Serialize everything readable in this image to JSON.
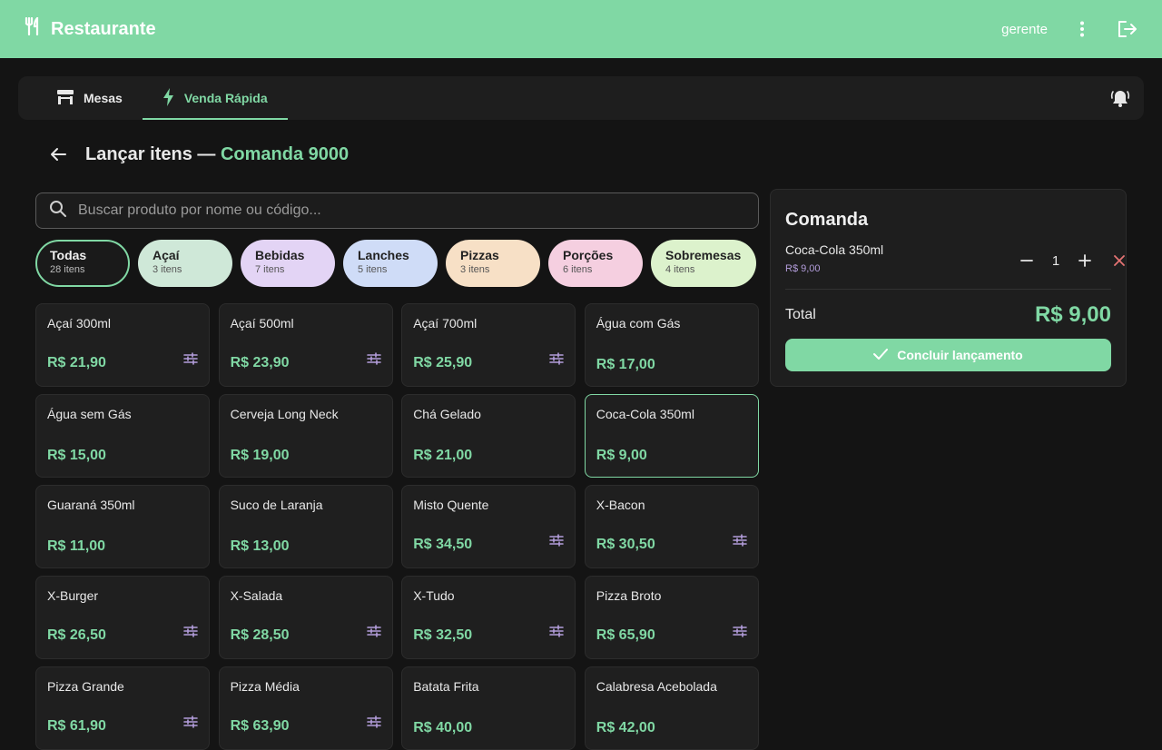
{
  "appbar": {
    "title": "Restaurante",
    "user": "gerente",
    "icons": [
      "fork-knife-icon",
      "more-vert-icon",
      "logout-icon"
    ]
  },
  "tabs": [
    {
      "label": "Mesas",
      "icon": "table-icon",
      "active": false
    },
    {
      "label": "Venda Rápida",
      "icon": "bolt-icon",
      "active": true
    }
  ],
  "heading": {
    "prefix": "Lançar itens —",
    "comanda": "Comanda 9000"
  },
  "search": {
    "placeholder": "Buscar produto por nome ou código...",
    "value": ""
  },
  "categories": [
    {
      "name": "Todas",
      "count": "28 itens",
      "color": "#1a1a1a",
      "active": true
    },
    {
      "name": "Açaí",
      "count": "3 itens",
      "color": "#cfe8d8"
    },
    {
      "name": "Bebidas",
      "count": "7 itens",
      "color": "#e3d4f5"
    },
    {
      "name": "Lanches",
      "count": "5 itens",
      "color": "#cfdcf7"
    },
    {
      "name": "Pizzas",
      "count": "3 itens",
      "color": "#f7e0c6"
    },
    {
      "name": "Porções",
      "count": "6 itens",
      "color": "#f5cfe0"
    },
    {
      "name": "Sobremesas",
      "count": "4 itens",
      "color": "#dcf2cc"
    }
  ],
  "products": [
    {
      "name": "Açaí 300ml",
      "price": "R$ 21,90",
      "options": true
    },
    {
      "name": "Açaí 500ml",
      "price": "R$ 23,90",
      "options": true
    },
    {
      "name": "Açaí 700ml",
      "price": "R$ 25,90",
      "options": true
    },
    {
      "name": "Água com Gás",
      "price": "R$ 17,00",
      "options": false
    },
    {
      "name": "Água sem Gás",
      "price": "R$ 15,00",
      "options": false
    },
    {
      "name": "Cerveja Long Neck",
      "price": "R$ 19,00",
      "options": false
    },
    {
      "name": "Chá Gelado",
      "price": "R$ 21,00",
      "options": false
    },
    {
      "name": "Coca-Cola 350ml",
      "price": "R$ 9,00",
      "options": false,
      "selected": true
    },
    {
      "name": "Guaraná 350ml",
      "price": "R$ 11,00",
      "options": false
    },
    {
      "name": "Suco de Laranja",
      "price": "R$ 13,00",
      "options": false
    },
    {
      "name": "Misto Quente",
      "price": "R$ 34,50",
      "options": true
    },
    {
      "name": "X-Bacon",
      "price": "R$ 30,50",
      "options": true
    },
    {
      "name": "X-Burger",
      "price": "R$ 26,50",
      "options": true
    },
    {
      "name": "X-Salada",
      "price": "R$ 28,50",
      "options": true
    },
    {
      "name": "X-Tudo",
      "price": "R$ 32,50",
      "options": true
    },
    {
      "name": "Pizza Broto",
      "price": "R$ 65,90",
      "options": true
    },
    {
      "name": "Pizza Grande",
      "price": "R$ 61,90",
      "options": true
    },
    {
      "name": "Pizza Média",
      "price": "R$ 63,90",
      "options": true
    },
    {
      "name": "Batata Frita",
      "price": "R$ 40,00",
      "options": false
    },
    {
      "name": "Calabresa Acebolada",
      "price": "R$ 42,00",
      "options": false
    }
  ],
  "comanda": {
    "title": "Comanda",
    "items": [
      {
        "name": "Coca-Cola 350ml",
        "price": "R$ 9,00",
        "qty": "1"
      }
    ],
    "total_label": "Total",
    "total_value": "R$ 9,00",
    "confirm_label": "Concluir lançamento"
  },
  "colors": {
    "accent": "#80d8a4",
    "price_secondary": "#b39ddb",
    "remove": "#e57373"
  }
}
